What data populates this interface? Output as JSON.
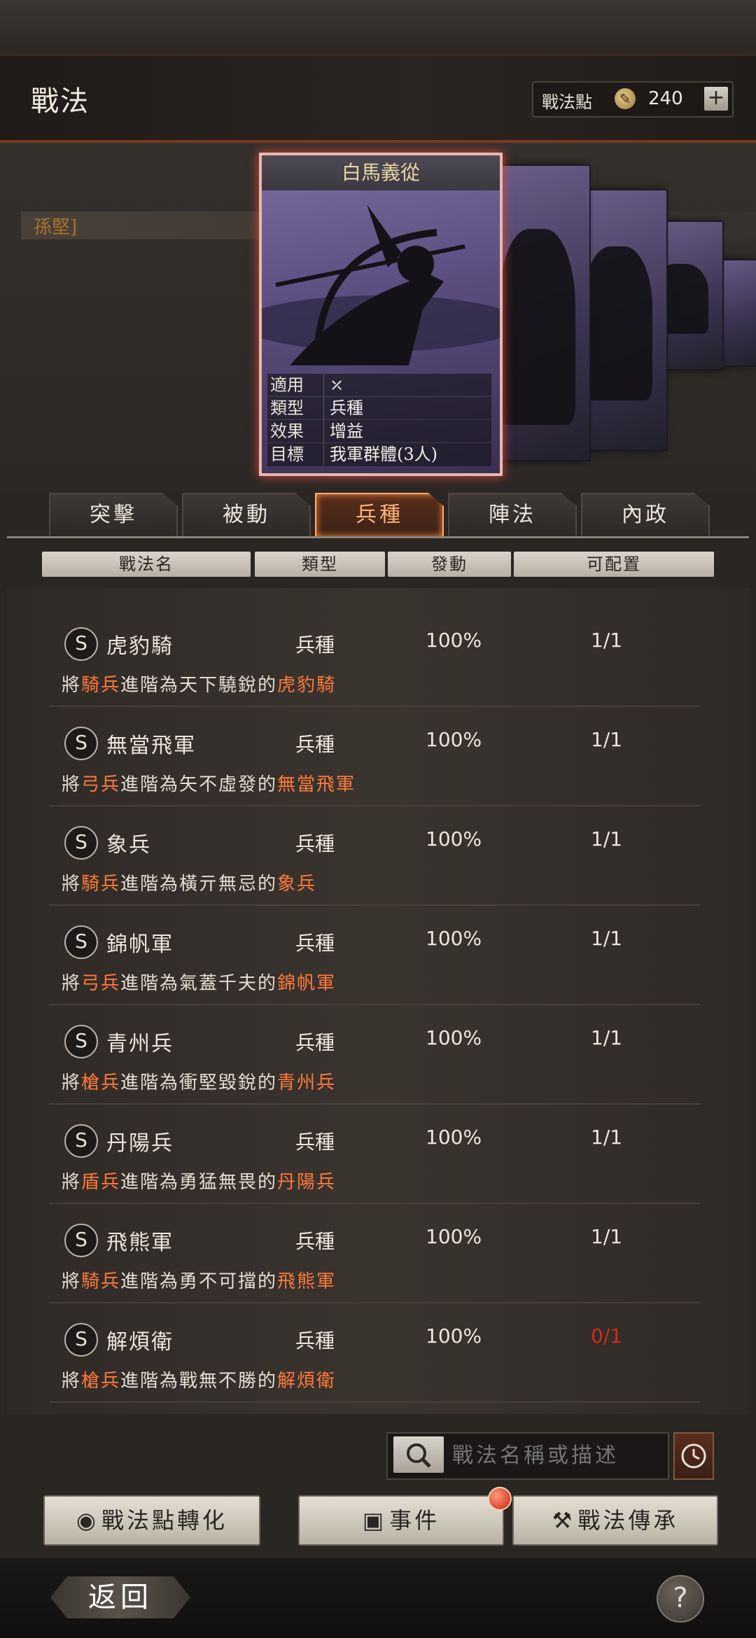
{
  "header": {
    "title": "戰法",
    "points_label": "戰法點",
    "points_value": "240",
    "add_label": "+"
  },
  "general": {
    "name": "孫堅]"
  },
  "card": {
    "title": "白馬義從",
    "info": [
      {
        "key": "適用",
        "value": ""
      },
      {
        "key": "類型",
        "value": "兵種"
      },
      {
        "key": "效果",
        "value": "增益"
      },
      {
        "key": "目標",
        "value": "我軍群體(3人)"
      }
    ]
  },
  "tabs": [
    "突擊",
    "被動",
    "兵種",
    "陣法",
    "內政"
  ],
  "active_tab": 2,
  "columns": [
    "戰法名",
    "類型",
    "發動",
    "可配置"
  ],
  "rows": [
    {
      "badge": "S",
      "name": "虎豹騎",
      "type": "兵種",
      "rate": "100%",
      "count": "1/1",
      "count_status": "normal",
      "d1": "將",
      "d2": "騎兵",
      "d3": "進階為天下驍銳的",
      "d4": "虎豹騎"
    },
    {
      "badge": "S",
      "name": "無當飛軍",
      "type": "兵種",
      "rate": "100%",
      "count": "1/1",
      "count_status": "normal",
      "d1": "將",
      "d2": "弓兵",
      "d3": "進階為矢不虛發的",
      "d4": "無當飛軍"
    },
    {
      "badge": "S",
      "name": "象兵",
      "type": "兵種",
      "rate": "100%",
      "count": "1/1",
      "count_status": "normal",
      "d1": "將",
      "d2": "騎兵",
      "d3": "進階為橫亓無忌的",
      "d4": "象兵"
    },
    {
      "badge": "S",
      "name": "錦帆軍",
      "type": "兵種",
      "rate": "100%",
      "count": "1/1",
      "count_status": "normal",
      "d1": "將",
      "d2": "弓兵",
      "d3": "進階為氣蓋千夫的",
      "d4": "錦帆軍"
    },
    {
      "badge": "S",
      "name": "青州兵",
      "type": "兵種",
      "rate": "100%",
      "count": "1/1",
      "count_status": "normal",
      "d1": "將",
      "d2": "槍兵",
      "d3": "進階為衝堅毀銳的",
      "d4": "青州兵"
    },
    {
      "badge": "S",
      "name": "丹陽兵",
      "type": "兵種",
      "rate": "100%",
      "count": "1/1",
      "count_status": "normal",
      "d1": "將",
      "d2": "盾兵",
      "d3": "進階為勇猛無畏的",
      "d4": "丹陽兵"
    },
    {
      "badge": "S",
      "name": "飛熊軍",
      "type": "兵種",
      "rate": "100%",
      "count": "1/1",
      "count_status": "normal",
      "d1": "將",
      "d2": "騎兵",
      "d3": "進階為勇不可擋的",
      "d4": "飛熊軍"
    },
    {
      "badge": "S",
      "name": "解煩衛",
      "type": "兵種",
      "rate": "100%",
      "count": "0/1",
      "count_status": "red",
      "d1": "將",
      "d2": "槍兵",
      "d3": "進階為戰無不勝的",
      "d4": "解煩衛"
    }
  ],
  "search": {
    "placeholder": "戰法名稱或描述"
  },
  "bottom_buttons": {
    "convert": "戰法點轉化",
    "event": "事件",
    "inherit": "戰法傳承"
  },
  "footer": {
    "back": "返回",
    "help": "?"
  },
  "colors": {
    "highlight": "#ff7a3a",
    "active_tab": "#ffab6a",
    "zero_count": "#d5281c"
  }
}
